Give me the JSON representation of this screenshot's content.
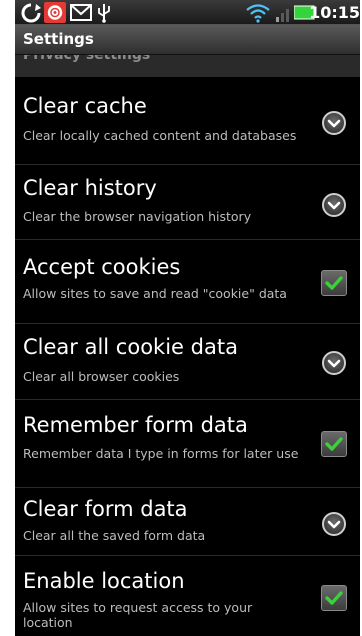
{
  "status_bar": {
    "time": "10:15",
    "icons": [
      "sync-icon",
      "email-app-icon",
      "gmail-icon",
      "usb-icon",
      "wifi-icon",
      "signal-icon",
      "battery-icon"
    ],
    "battery_color": "#36d43c",
    "wifi_color": "#4fc3f7"
  },
  "title_bar": {
    "title": "Settings"
  },
  "section": {
    "header": "Privacy settings"
  },
  "items": [
    {
      "title": "Clear cache",
      "summary": "Clear locally cached content and databases",
      "widget": "chevron"
    },
    {
      "title": "Clear history",
      "summary": "Clear the browser navigation history",
      "widget": "chevron"
    },
    {
      "title": "Accept cookies",
      "summary": "Allow sites to save and read \"cookie\" data",
      "widget": "checkbox",
      "checked": true
    },
    {
      "title": "Clear all cookie data",
      "summary": "Clear all browser cookies",
      "widget": "chevron"
    },
    {
      "title": "Remember form data",
      "summary": "Remember data I type in forms for later use",
      "widget": "checkbox",
      "checked": true
    },
    {
      "title": "Clear form data",
      "summary": "Clear all the saved form data",
      "widget": "chevron"
    },
    {
      "title": "Enable location",
      "summary": "Allow sites to request access to your location",
      "widget": "checkbox",
      "checked": true
    }
  ],
  "colors": {
    "check_green": "#3ad13a",
    "background": "#000000"
  }
}
